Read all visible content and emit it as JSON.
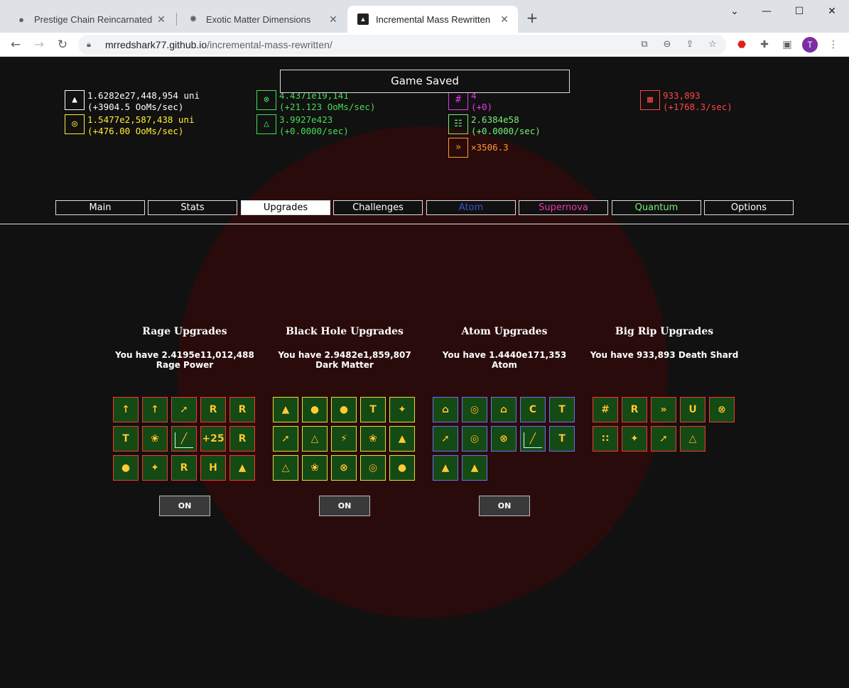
{
  "browser": {
    "tabs": [
      {
        "title": "Prestige Chain Reincarnated",
        "icon": "globe-icon",
        "glyph": "●"
      },
      {
        "title": "Exotic Matter Dimensions",
        "icon": "star-icon",
        "glyph": "✸"
      },
      {
        "title": "Incremental Mass Rewritten",
        "icon": "weight-icon",
        "glyph": "▲"
      }
    ],
    "new_tab": "+",
    "url_host": "mrredshark77.github.io",
    "url_path": "/incremental-mass-rewritten/",
    "profile_initial": "T"
  },
  "game": {
    "saved_banner": "Game Saved",
    "resources": [
      {
        "name": "mass",
        "icon": "weight-icon",
        "glyph": "▲",
        "line1": "1.6282e27,448,954 uni",
        "line2": "(+3904.5 OoMs/sec)",
        "color": "#ffffff"
      },
      {
        "name": "black-hole",
        "icon": "ring-icon",
        "glyph": "◎",
        "line1": "1.5477e2,587,438 uni",
        "line2": "(+476.00 OoMs/sec)",
        "color": "#ffee33"
      },
      {
        "name": "atom",
        "icon": "atom-icon",
        "glyph": "⊗",
        "line1": "4.4371e19,141",
        "line2": "(+21.123 OoMs/sec)",
        "color": "#44dd55"
      },
      {
        "name": "quark",
        "icon": "triangle-icon",
        "glyph": "△",
        "line1": "3.9927e423",
        "line2": "(+0.0000/sec)",
        "color": "#44dd55"
      },
      {
        "name": "supernova",
        "icon": "hash-icon",
        "glyph": "#",
        "line1": "4",
        "line2": "(+0)",
        "color": "#ee33ee"
      },
      {
        "name": "quantum",
        "icon": "grid-icon",
        "glyph": "☷",
        "line1": "2.6384e58",
        "line2": "(+0.0000/sec)",
        "color": "#77ee77"
      },
      {
        "name": "speed",
        "icon": "fast-forward-icon",
        "glyph": "»",
        "line1": "×3506.3",
        "line2": "",
        "color": "#ff9933"
      },
      {
        "name": "death-shard",
        "icon": "maze-icon",
        "glyph": "▦",
        "line1": "933,893",
        "line2": "(+1768.3/sec)",
        "color": "#ff4444"
      }
    ],
    "tabs": [
      {
        "label": "Main",
        "color": "#ffffff"
      },
      {
        "label": "Stats",
        "color": "#ffffff"
      },
      {
        "label": "Upgrades",
        "color": "#000000"
      },
      {
        "label": "Challenges",
        "color": "#ffffff"
      },
      {
        "label": "Atom",
        "color": "#3355cc"
      },
      {
        "label": "Supernova",
        "color": "#ee33aa"
      },
      {
        "label": "Quantum",
        "color": "#77ee77"
      },
      {
        "label": "Options",
        "color": "#ffffff"
      }
    ],
    "panels": [
      {
        "title": "Rage Upgrades",
        "desc": "You have 2.4195e11,012,488 Rage Power",
        "toggle": "ON"
      },
      {
        "title": "Black Hole Upgrades",
        "desc": "You have 2.9482e1,859,807 Dark Matter",
        "toggle": "ON"
      },
      {
        "title": "Atom Upgrades",
        "desc": "You have 1.4440e171,353 Atom",
        "toggle": "ON"
      },
      {
        "title": "Big Rip Upgrades",
        "desc": "You have 933,893 Death Shard",
        "toggle": ""
      }
    ],
    "upgrades": {
      "rage": [
        "↑",
        "↑",
        "➚",
        "R",
        "R",
        "T",
        "❀",
        "╱",
        "+25",
        "R",
        "●",
        "✦",
        "R",
        "H",
        "▲"
      ],
      "black_hole": [
        "▲",
        "●",
        "●",
        "T",
        "✦",
        "➚",
        "△",
        "⚡",
        "❀",
        "▲",
        "△",
        "❀",
        "⊗",
        "◎",
        "●"
      ],
      "atom": [
        "⌂",
        "◎",
        "⌂",
        "C",
        "T",
        "➚",
        "◎",
        "⊗",
        "╱",
        "T",
        "▲",
        "▲"
      ],
      "big_rip": [
        "#",
        "R",
        "»",
        "U",
        "⊗",
        "∷",
        "✦",
        "➚",
        "△"
      ]
    }
  }
}
